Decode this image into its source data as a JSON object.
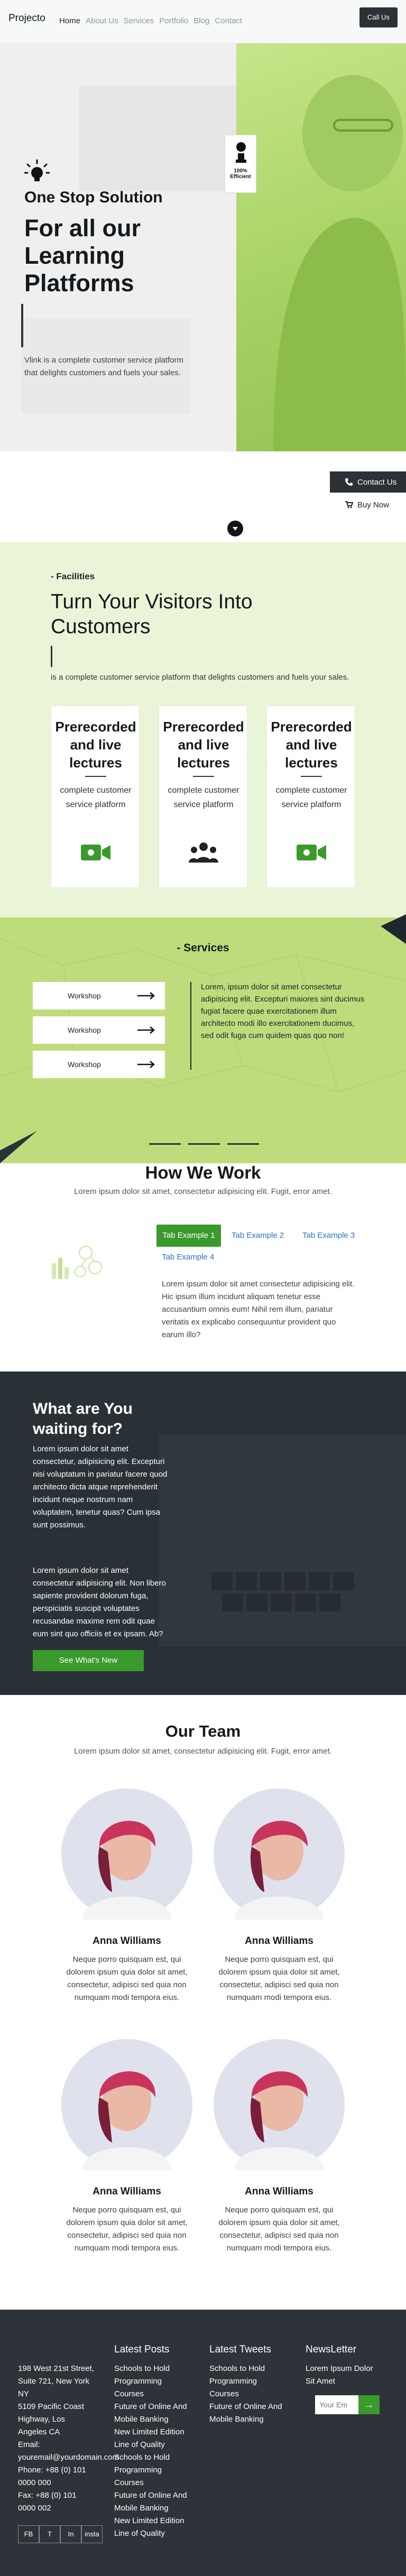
{
  "header": {
    "logo": "Projecto",
    "nav": [
      "Home",
      "About Us",
      "Services",
      "Portfolio",
      "Blog",
      "Contact"
    ],
    "call_button": "Call Us"
  },
  "hero": {
    "badge_top": "100%",
    "badge_bottom": "Efficient",
    "subtitle": "One Stop Solution",
    "title": "For all our Learning Platforms",
    "description": "Vlink is a complete customer service platform that delights customers and fuels your sales.",
    "accent": "#a9d466"
  },
  "actions": {
    "contact": "Contact Us",
    "buy": "Buy Now"
  },
  "facilities": {
    "label": "- Facilities",
    "title": "Turn Your Visitors Into Customers",
    "description": "is a complete customer service platform that delights customers and fuels your sales.",
    "cards": [
      {
        "title": "Prerecorded and live lectures",
        "desc": "complete customer service platform",
        "icon": "video-camera-icon"
      },
      {
        "title": "Prerecorded and live lectures",
        "desc": "complete customer service platform",
        "icon": "users-icon"
      },
      {
        "title": "Prerecorded and live lectures",
        "desc": "complete customer service platform",
        "icon": "video-camera-icon"
      }
    ]
  },
  "services": {
    "title": "- Services",
    "items": [
      "Workshop",
      "Workshop",
      "Workshop"
    ],
    "description": "Lorem, ipsum dolor sit amet consectetur adipisicing elit. Excepturi maiores sint ducimus fugiat facere quae exercitationem illum architecto modi illo exercitationem ducimus, sed odit fuga cum quidem quas quo non!"
  },
  "how_we_work": {
    "title": "How We Work",
    "subtitle": "Lorem ipsum dolor sit amet, consectetur adipisicing elit. Fugit, error amet.",
    "tabs": [
      "Tab Example 1",
      "Tab Example 2",
      "Tab Example 3",
      "Tab Example 4"
    ],
    "active_tab": "Tab Example 1",
    "description": "Lorem ipsum dolor sit amet consectetur adipisicing elit. Hic ipsum illum incidunt aliquam tenetur esse accusantium omnis eum! Nihil rem illum, pariatur veritatis ex explicabo consequuntur provident quo earum illo?"
  },
  "cta": {
    "title": "What are You waiting for?",
    "paragraph1": "Lorem ipsum dolor sit amet consectetur, adipisicing elit. Excepturi nisi voluptatum in pariatur facere quod architecto dicta atque reprehenderit incidunt neque nostrum nam voluptatem, tenetur quas? Cum ipsa sunt possimus.",
    "paragraph2": "Lorem ipsum dolor sit amet consectetur adipisicing elit. Non libero sapiente provident dolorum fuga, perspiciatis suscipit voluptates recusandae maxime rem odit quae eum sint quo officiis et ex ipsam. Ab?",
    "button": "See What's New"
  },
  "team": {
    "title": "Our Team",
    "subtitle": "Lorem ipsum dolor sit amet, consectetur adipisicing elit. Fugit, error amet.",
    "members": [
      {
        "name": "Anna Williams",
        "bio": "Neque porro quisquam est, qui dolorem ipsum quia dolor sit amet, consectetur, adipisci sed quia non numquam modi tempora eius."
      },
      {
        "name": "Anna Williams",
        "bio": "Neque porro quisquam est, qui dolorem ipsum quia dolor sit amet, consectetur, adipisci sed quia non numquam modi tempora eius."
      },
      {
        "name": "Anna Williams",
        "bio": "Neque porro quisquam est, qui dolorem ipsum quia dolor sit amet, consectetur, adipisci sed quia non numquam modi tempora eius."
      },
      {
        "name": "Anna Williams",
        "bio": "Neque porro quisquam est, qui dolorem ipsum quia dolor sit amet, consectetur, adipisci sed quia non numquam modi tempora eius."
      }
    ]
  },
  "footer": {
    "address_lines": [
      "198 West 21st Street,",
      "Suite 721, New York",
      "NY",
      "5109 Pacific Coast",
      "Highway, Los",
      "Angeles CA",
      "Email:",
      "youremail@yourdomain.com",
      "Phone: +88 (0) 101",
      "0000 000",
      "Fax: +88 (0) 101",
      "0000 002"
    ],
    "social": [
      "FB",
      "T",
      "In",
      "insta"
    ],
    "latest_posts": {
      "title": "Latest Posts",
      "items": [
        "Schools to Hold",
        "Programming",
        "Courses",
        "Future of Online And",
        "Mobile Banking",
        "New Limited Edition",
        "Line of Quality",
        "Schools to Hold",
        "Programming",
        "Courses",
        "Future of Online And",
        "Mobile Banking",
        "New Limited Edition",
        "Line of Quality"
      ]
    },
    "latest_tweets": {
      "title": "Latest Tweets",
      "items": [
        "Schools to Hold",
        "Programming",
        "Courses",
        "Future of Online And",
        "Mobile Banking"
      ]
    },
    "newsletter": {
      "title": "NewsLetter",
      "text_lines": [
        "Lorem Ipsum Dolor",
        "Sit Amet"
      ],
      "placeholder": "Your Em",
      "submit": "→"
    }
  }
}
